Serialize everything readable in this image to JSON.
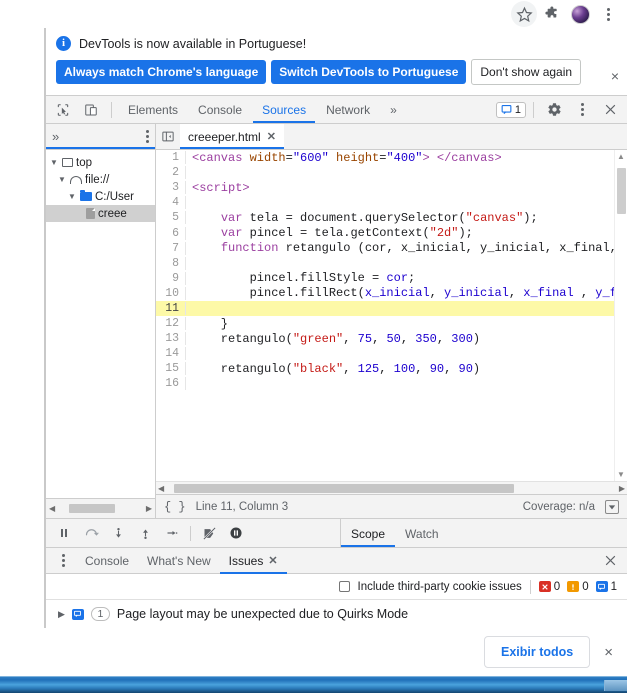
{
  "browser": {
    "icons": {
      "bookmark": "star-icon",
      "extensions": "puzzle-icon",
      "profile": "avatar-icon",
      "menu": "three-dot-menu-icon"
    }
  },
  "devtools": {
    "banner": {
      "info_icon": "info-icon",
      "message": "DevTools is now available in Portuguese!",
      "buttons": [
        {
          "label": "Always match Chrome's language",
          "style": "primary"
        },
        {
          "label": "Switch DevTools to Portuguese",
          "style": "primary"
        },
        {
          "label": "Don't show again",
          "style": "secondary"
        }
      ],
      "close": "×"
    },
    "toolbar": {
      "inspect_icon": "inspect-element-icon",
      "device_icon": "device-toolbar-icon",
      "tabs": [
        {
          "label": "Elements",
          "active": false
        },
        {
          "label": "Console",
          "active": false
        },
        {
          "label": "Sources",
          "active": true
        },
        {
          "label": "Network",
          "active": false
        }
      ],
      "more_tabs": "»",
      "issues_count": "1",
      "settings_icon": "gear-icon",
      "more_icon": "three-dot-menu-icon",
      "close_icon": "close-icon"
    },
    "navigator": {
      "expand_icon": "»",
      "more_icon": "three-dot-menu-icon",
      "tree": [
        {
          "label": "top",
          "icon": "frame-icon",
          "twisty": "▼",
          "indent": 0,
          "selected": false
        },
        {
          "label": "file://",
          "icon": "cloud-icon",
          "twisty": "▼",
          "indent": 1,
          "selected": false
        },
        {
          "label": "C:/User",
          "icon": "folder-icon",
          "twisty": "▼",
          "indent": 2,
          "selected": false
        },
        {
          "label": "creee",
          "icon": "file-icon",
          "twisty": "",
          "indent": 3,
          "selected": true
        }
      ]
    },
    "editor": {
      "panel_toggle_icon": "show-navigator-icon",
      "tab": {
        "label": "creeeper.html",
        "close": "✕"
      },
      "lines": [
        {
          "n": "1",
          "highlight": false,
          "tokens": [
            {
              "t": "tag",
              "v": "<canvas "
            },
            {
              "t": "attr",
              "v": "width"
            },
            {
              "t": "plain",
              "v": "="
            },
            {
              "t": "num",
              "v": "\"600\""
            },
            {
              "t": "plain",
              "v": " "
            },
            {
              "t": "attr",
              "v": "height"
            },
            {
              "t": "plain",
              "v": "="
            },
            {
              "t": "num",
              "v": "\"400\""
            },
            {
              "t": "tag",
              "v": "> </canvas>"
            }
          ]
        },
        {
          "n": "2",
          "highlight": false,
          "tokens": []
        },
        {
          "n": "3",
          "highlight": false,
          "tokens": [
            {
              "t": "tag",
              "v": "<script>"
            }
          ]
        },
        {
          "n": "4",
          "highlight": false,
          "tokens": []
        },
        {
          "n": "5",
          "highlight": false,
          "tokens": [
            {
              "t": "plain",
              "v": "    "
            },
            {
              "t": "kw",
              "v": "var"
            },
            {
              "t": "plain",
              "v": " tela = document.querySelector("
            },
            {
              "t": "str",
              "v": "\"canvas\""
            },
            {
              "t": "plain",
              "v": ");"
            }
          ]
        },
        {
          "n": "6",
          "highlight": false,
          "tokens": [
            {
              "t": "plain",
              "v": "    "
            },
            {
              "t": "kw",
              "v": "var"
            },
            {
              "t": "plain",
              "v": " pincel = tela.getContext("
            },
            {
              "t": "str",
              "v": "\"2d\""
            },
            {
              "t": "plain",
              "v": ");"
            }
          ]
        },
        {
          "n": "7",
          "highlight": false,
          "tokens": [
            {
              "t": "plain",
              "v": "    "
            },
            {
              "t": "kw",
              "v": "function"
            },
            {
              "t": "plain",
              "v": " retangulo (cor, x_inicial, y_inicial, x_final, y_f"
            }
          ]
        },
        {
          "n": "8",
          "highlight": false,
          "tokens": []
        },
        {
          "n": "9",
          "highlight": false,
          "tokens": [
            {
              "t": "plain",
              "v": "        pincel.fillStyle = "
            },
            {
              "t": "var",
              "v": "cor"
            },
            {
              "t": "plain",
              "v": ";"
            }
          ]
        },
        {
          "n": "10",
          "highlight": false,
          "tokens": [
            {
              "t": "plain",
              "v": "        pincel.fillRect("
            },
            {
              "t": "var",
              "v": "x_inicial"
            },
            {
              "t": "plain",
              "v": ", "
            },
            {
              "t": "var",
              "v": "y_inicial"
            },
            {
              "t": "plain",
              "v": ", "
            },
            {
              "t": "var",
              "v": "x_final"
            },
            {
              "t": "plain",
              "v": " , "
            },
            {
              "t": "var",
              "v": "y_final"
            }
          ]
        },
        {
          "n": "11",
          "highlight": true,
          "tokens": []
        },
        {
          "n": "12",
          "highlight": false,
          "tokens": [
            {
              "t": "plain",
              "v": "    }"
            }
          ]
        },
        {
          "n": "13",
          "highlight": false,
          "tokens": [
            {
              "t": "plain",
              "v": "    retangulo("
            },
            {
              "t": "str",
              "v": "\"green\""
            },
            {
              "t": "plain",
              "v": ", "
            },
            {
              "t": "num",
              "v": "75"
            },
            {
              "t": "plain",
              "v": ", "
            },
            {
              "t": "num",
              "v": "50"
            },
            {
              "t": "plain",
              "v": ", "
            },
            {
              "t": "num",
              "v": "350"
            },
            {
              "t": "plain",
              "v": ", "
            },
            {
              "t": "num",
              "v": "300"
            },
            {
              "t": "plain",
              "v": ")"
            }
          ]
        },
        {
          "n": "14",
          "highlight": false,
          "tokens": []
        },
        {
          "n": "15",
          "highlight": false,
          "tokens": [
            {
              "t": "plain",
              "v": "    retangulo("
            },
            {
              "t": "str",
              "v": "\"black\""
            },
            {
              "t": "plain",
              "v": ", "
            },
            {
              "t": "num",
              "v": "125"
            },
            {
              "t": "plain",
              "v": ", "
            },
            {
              "t": "num",
              "v": "100"
            },
            {
              "t": "plain",
              "v": ", "
            },
            {
              "t": "num",
              "v": "90"
            },
            {
              "t": "plain",
              "v": ", "
            },
            {
              "t": "num",
              "v": "90"
            },
            {
              "t": "plain",
              "v": ")"
            }
          ]
        },
        {
          "n": "16",
          "highlight": false,
          "tokens": []
        }
      ],
      "status": {
        "format_icon": "pretty-print-icon",
        "position": "Line 11, Column 3",
        "coverage": "Coverage: n/a",
        "coverage_icon": "coverage-drawer-icon"
      }
    },
    "debugger": {
      "buttons": [
        {
          "icon": "pause-icon",
          "name": "pause-script-button"
        },
        {
          "icon": "step-over-icon",
          "name": "step-over-button"
        },
        {
          "icon": "step-into-icon",
          "name": "step-into-button"
        },
        {
          "icon": "step-out-icon",
          "name": "step-out-button"
        },
        {
          "icon": "step-icon",
          "name": "step-button"
        },
        {
          "icon": "deactivate-breakpoints-icon",
          "name": "deactivate-breakpoints-button"
        },
        {
          "icon": "pause-on-exceptions-icon",
          "name": "pause-on-exceptions-button"
        }
      ],
      "tabs": [
        {
          "label": "Scope",
          "active": true
        },
        {
          "label": "Watch",
          "active": false
        }
      ]
    },
    "drawer": {
      "more_icon": "three-dot-menu-icon",
      "tabs": [
        {
          "label": "Console",
          "active": false,
          "closable": false
        },
        {
          "label": "What's New",
          "active": false,
          "closable": false
        },
        {
          "label": "Issues",
          "active": true,
          "closable": true
        }
      ],
      "close_icon": "close-icon",
      "filter": {
        "checkbox_label": "Include third-party cookie issues",
        "checked": false,
        "counts": [
          {
            "type": "error",
            "value": "0",
            "color": "#d93025"
          },
          {
            "type": "warning",
            "value": "0",
            "color": "#f29900"
          },
          {
            "type": "info",
            "value": "1",
            "color": "#1a73e8"
          }
        ]
      },
      "issues": [
        {
          "twisty": "▶",
          "icon": "info-issue-icon",
          "badge": "1",
          "text": "Page layout may be unexpected due to Quirks Mode"
        }
      ]
    }
  },
  "infobar": {
    "button_label": "Exibir todos",
    "close": "×"
  }
}
